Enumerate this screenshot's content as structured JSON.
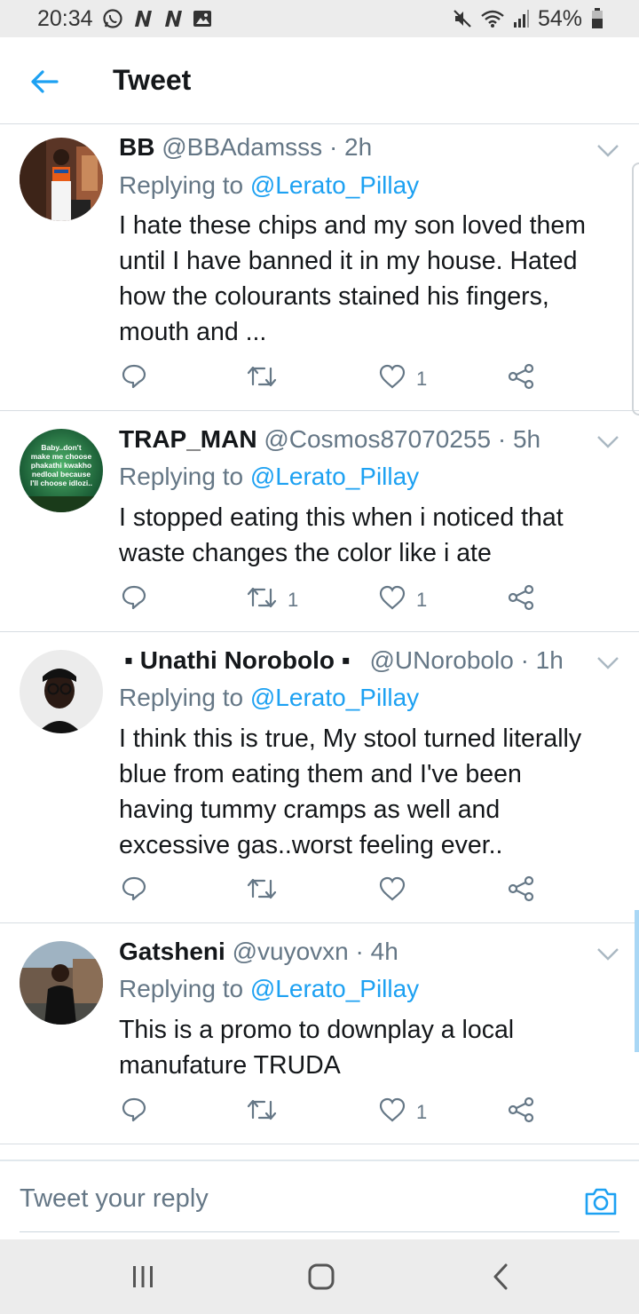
{
  "status_bar": {
    "time": "20:34",
    "battery": "54%",
    "icons": [
      "whatsapp-icon",
      "n-notification-icon",
      "n-notification-icon",
      "image-icon",
      "mute-icon",
      "wifi-icon",
      "signal-icon",
      "battery-icon"
    ]
  },
  "header": {
    "title": "Tweet",
    "back_icon": "arrow-left-icon"
  },
  "colors": {
    "accent": "#1da1f2",
    "secondary_text": "#657786",
    "primary_text": "#14171a",
    "divider": "#d7dde2"
  },
  "tweets": [
    {
      "name": "BB",
      "handle": "@BBAdamsss",
      "time": "2h",
      "replying_prefix": "Replying to",
      "replying_to": "@Lerato_Pillay",
      "text_lines": [
        "I hate these chips and my son loved them",
        "until I have banned it in my house. Hated",
        "how the colourants stained his fingers,",
        "mouth and ..."
      ],
      "retweets": "",
      "likes": "1"
    },
    {
      "name": "TRAP_MAN",
      "handle": "@Cosmos87070255",
      "time": "5h",
      "replying_prefix": "Replying to",
      "replying_to": "@Lerato_Pillay",
      "text_lines": [
        "I stopped eating this when i noticed that",
        "waste changes the color like i ate"
      ],
      "retweets": "1",
      "likes": "1",
      "avatar_text": [
        "Baby..don't",
        "make me choose",
        "phakathi kwakho",
        "nedloal because",
        "I'll choose idlozi.."
      ]
    },
    {
      "name": "▪ Unathi Norobolo ▪",
      "handle": "@UNorobolo",
      "time": "1h",
      "replying_prefix": "Replying to",
      "replying_to": "@Lerato_Pillay",
      "text_lines": [
        "I think this is true, My stool turned literally",
        "blue from eating them and I've been",
        "having tummy cramps as well and",
        "excessive gas..worst feeling ever.."
      ],
      "retweets": "",
      "likes": ""
    },
    {
      "name": "Gatsheni",
      "handle": "@vuyovxn",
      "time": "4h",
      "replying_prefix": "Replying to",
      "replying_to": "@Lerato_Pillay",
      "text_lines": [
        "This is a promo to downplay a local",
        "manufature TRUDA"
      ],
      "retweets": "",
      "likes": "1"
    }
  ],
  "compose": {
    "placeholder": "Tweet your reply",
    "camera_icon": "camera-icon"
  },
  "nav_bar": {
    "buttons": [
      "recent-apps-icon",
      "home-icon",
      "back-icon"
    ]
  }
}
